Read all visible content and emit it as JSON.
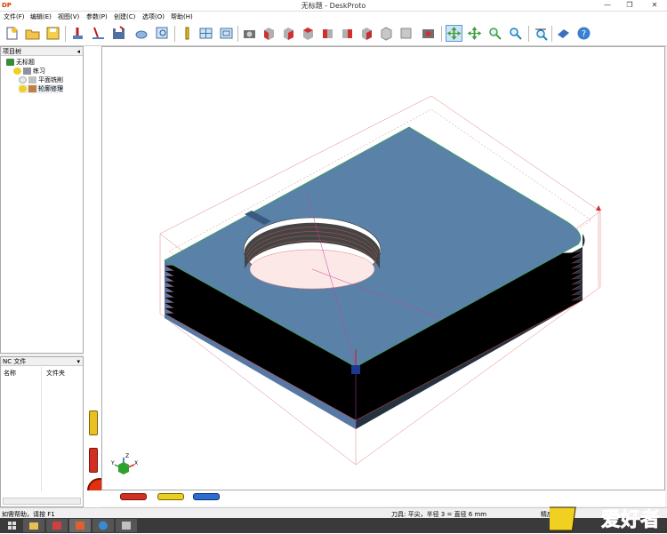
{
  "window": {
    "title": "无标题 - DeskProto",
    "app_icon_text": "DP",
    "controls": {
      "minimize": "—",
      "maximize": "❐",
      "close": "✕"
    }
  },
  "menu": [
    "文件(F)",
    "编辑(E)",
    "视图(V)",
    "参数(P)",
    "创建(C)",
    "选项(O)",
    "帮助(H)"
  ],
  "toolbar_icons": [
    "new-icon",
    "open-icon",
    "save-icon",
    "add-part-icon",
    "cut-icon",
    "save-as-icon",
    "zoom-part-icon",
    "search-icon",
    "info-icon",
    "grid-icon",
    "frame-icon",
    "machine-icon",
    "view-front-icon",
    "view-back-icon",
    "view-left-icon",
    "view-right-icon",
    "view-top-icon",
    "view-bottom-icon",
    "view-iso-icon",
    "view-box-icon",
    "render-icon",
    "pan-icon",
    "move-icon",
    "zoom-icon",
    "zoom-window-icon",
    "zoom-100-icon",
    "eraser-icon",
    "help-icon"
  ],
  "tree": {
    "header": "项目树",
    "pin": "◂",
    "items": [
      {
        "label": "无标题",
        "level": 0
      },
      {
        "label": "练习",
        "level": 1
      },
      {
        "label": "平面铣削",
        "level": 2
      },
      {
        "label": "轮廓修理",
        "level": 2
      }
    ]
  },
  "nc_panel": {
    "header": "NC 文件",
    "pin": "▾",
    "columns": [
      "名称",
      "文件夹"
    ]
  },
  "bottom_buttons": [
    {
      "label": "",
      "color": "#d02020"
    },
    {
      "label": "",
      "color": "#e8d020"
    },
    {
      "label": "",
      "color": "#2a6fd0"
    }
  ],
  "status": {
    "help": "如需帮助，请按 F1",
    "tool": "刀具: 平尖，半径 3 = 直径 6 mm",
    "precision": "精度"
  },
  "watermark": "爱好者",
  "axes": {
    "x": "X",
    "y": "Y",
    "z": "Z"
  },
  "colors": {
    "part_top": "#5a82a8",
    "part_side": "#243240",
    "toolpath": "#e05050",
    "accent": "#2c5aa0"
  }
}
